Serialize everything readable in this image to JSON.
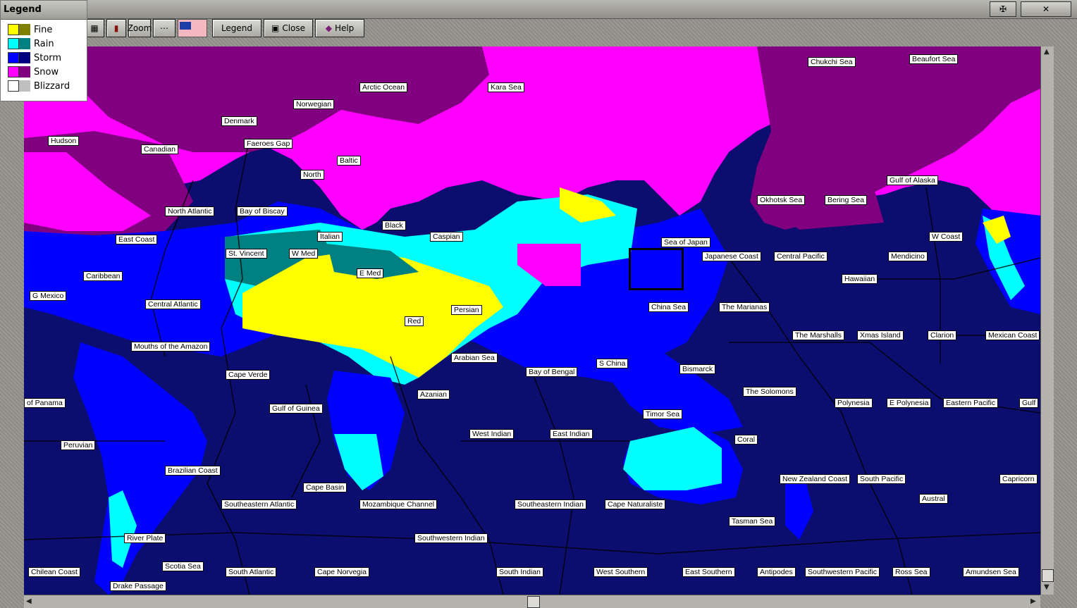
{
  "legend": {
    "title": "Legend",
    "items": [
      {
        "label": "Fine",
        "light": "#ffff00",
        "dark": "#808000"
      },
      {
        "label": "Rain",
        "light": "#00ffff",
        "dark": "#008080"
      },
      {
        "label": "Storm",
        "light": "#0000ff",
        "dark": "#000080"
      },
      {
        "label": "Snow",
        "light": "#ff00ff",
        "dark": "#800080"
      },
      {
        "label": "Blizzard",
        "light": "#ffffff",
        "dark": "#c0c0c0"
      }
    ]
  },
  "toolbar": {
    "zoom_label": "Zoom",
    "legend_label": "Legend",
    "close_label": "Close",
    "help_label": "Help"
  },
  "map": {
    "sea_zones": [
      "Chukchi Sea",
      "Beaufort Sea",
      "Arctic Ocean",
      "Kara Sea",
      "Norwegian",
      "Denmark",
      "Hudson",
      "Canadian",
      "Faeroes Gap",
      "Baltic",
      "North",
      "North Atlantic",
      "Bay of Biscay",
      "Gulf of Alaska",
      "Okhotsk Sea",
      "Bering Sea",
      "Black",
      "Italian",
      "Caspian",
      "East Coast",
      "St. Vincent",
      "W Med",
      "Sea of Japan",
      "W Coast",
      "Japanese Coast",
      "Central Pacific",
      "Mendicino",
      "E Med",
      "Caribbean",
      "Hawaiian",
      "G Mexico",
      "Central Atlantic",
      "Persian",
      "China Sea",
      "The Marianas",
      "Red",
      "The Marshalls",
      "Xmas Island",
      "Clarion",
      "Mexican Coast",
      "Mouths of the Amazon",
      "Arabian Sea",
      "S China",
      "Bay of Bengal",
      "Cape Verde",
      "Bismarck",
      "The Solomons",
      "Azanian",
      "of Panama",
      "Gulf of Guinea",
      "Polynesia",
      "E Polynesia",
      "Eastern Pacific",
      "Gulf",
      "Timor Sea",
      "West Indian",
      "East Indian",
      "Peruvian",
      "Coral",
      "Brazilian Coast",
      "New Zealand Coast",
      "South Pacific",
      "Capricorn",
      "Cape Basin",
      "Austral",
      "Southeastern Atlantic",
      "Mozambique Channel",
      "Southeastern Indian",
      "Cape Naturaliste",
      "Tasman Sea",
      "River Plate",
      "Southwestern Indian",
      "Scotia Sea",
      "Chilean Coast",
      "South Atlantic",
      "Cape Norvegia",
      "South Indian",
      "West Southern",
      "East Southern",
      "Antipodes",
      "Southwestern Pacific",
      "Ross Sea",
      "Amundsen Sea",
      "Drake Passage"
    ]
  }
}
